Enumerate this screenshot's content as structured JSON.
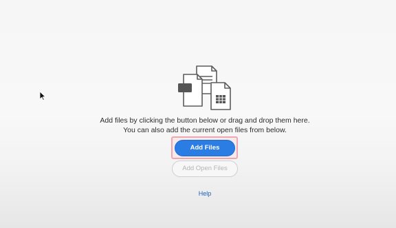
{
  "drop_zone": {
    "illustration_icon": "combine-files-icon",
    "instruction_line1": "Add files by clicking the button below or drag and drop them here.",
    "instruction_line2": "You can also add the current open files from below.",
    "add_files_label": "Add Files",
    "add_open_files_label": "Add Open Files",
    "help_label": "Help"
  },
  "cursor": {
    "icon": "mouse-pointer-icon"
  },
  "colors": {
    "primary_button": "#2b7de4",
    "focus_ring": "#f0a6ae",
    "link": "#1e5fb6",
    "disabled_text": "#b4b4b4"
  }
}
